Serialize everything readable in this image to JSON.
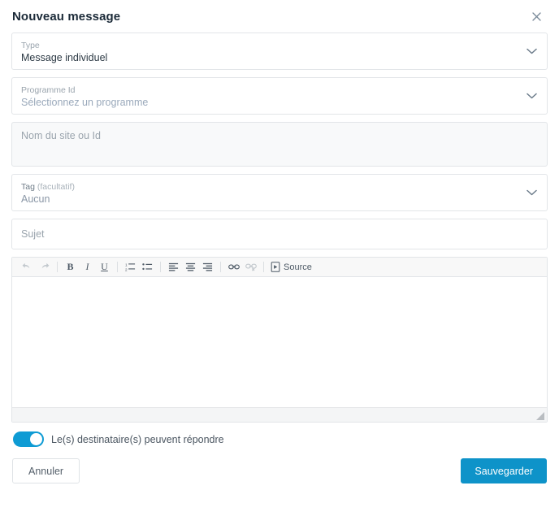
{
  "dialog": {
    "title": "Nouveau message",
    "close_icon": "close-icon"
  },
  "fields": {
    "type": {
      "label": "Type",
      "value": "Message individuel",
      "chevron_icon": "chevron-down-icon"
    },
    "programme": {
      "label": "Programme Id",
      "value": "Sélectionnez un programme",
      "chevron_icon": "chevron-down-icon"
    },
    "site": {
      "placeholder": "Nom du site ou Id"
    },
    "tag": {
      "label": "Tag",
      "label_suffix": "(facultatif)",
      "value": "Aucun",
      "chevron_icon": "chevron-down-icon"
    },
    "sujet": {
      "placeholder": "Sujet"
    }
  },
  "editor": {
    "toolbar": [
      {
        "name": "undo-icon",
        "label": "Annuler la frappe",
        "state": "dim"
      },
      {
        "name": "redo-icon",
        "label": "Rétablir",
        "state": "dim"
      },
      {
        "name": "bold-icon",
        "label": "Gras",
        "state": "normal"
      },
      {
        "name": "italic-icon",
        "label": "Italique",
        "state": "normal"
      },
      {
        "name": "underline-icon",
        "label": "Souligné",
        "state": "normal"
      },
      {
        "name": "numbered-list-icon",
        "label": "Liste numérotée",
        "state": "normal"
      },
      {
        "name": "bulleted-list-icon",
        "label": "Liste à puces",
        "state": "normal"
      },
      {
        "name": "align-left-icon",
        "label": "Aligner à gauche",
        "state": "normal"
      },
      {
        "name": "align-center-icon",
        "label": "Centrer",
        "state": "normal"
      },
      {
        "name": "align-right-icon",
        "label": "Aligner à droite",
        "state": "normal"
      },
      {
        "name": "link-icon",
        "label": "Lien",
        "state": "normal"
      },
      {
        "name": "unlink-icon",
        "label": "Supprimer le lien",
        "state": "dim"
      }
    ],
    "source_button": "Source",
    "source_icon": "source-document-icon",
    "content": "",
    "resize_icon": "resize-grip-icon"
  },
  "reply_toggle": {
    "label": "Le(s) destinataire(s) peuvent répondre",
    "enabled": true
  },
  "footer": {
    "cancel_label": "Annuler",
    "save_label": "Sauvegarder"
  },
  "colors": {
    "accent": "#0e93c9",
    "toggle_on": "#0e9bd4",
    "title": "#1b2a38",
    "border": "#e2e5e8",
    "disabled_bg": "#f8f9fa",
    "toolbar_bg": "#f8f8f8"
  }
}
